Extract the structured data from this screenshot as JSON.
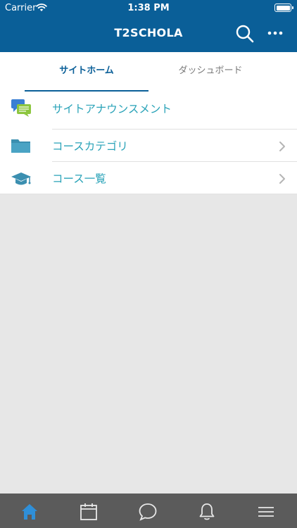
{
  "status_bar": {
    "carrier": "Carrier",
    "time": "1:38 PM"
  },
  "header": {
    "title": "T2SCHOLA",
    "search_icon": "search-icon",
    "more_icon": "more-icon"
  },
  "tabs": [
    {
      "label": "サイトホーム",
      "active": true
    },
    {
      "label": "ダッシュボード",
      "active": false
    }
  ],
  "menu": [
    {
      "label": "サイトアナウンスメント",
      "icon": "announcement-icon",
      "chevron": false
    },
    {
      "label": "コースカテゴリ",
      "icon": "folder-icon",
      "chevron": true
    },
    {
      "label": "コース一覧",
      "icon": "graduation-cap-icon",
      "chevron": true
    }
  ],
  "tab_bar": [
    {
      "icon": "home-icon",
      "active": true
    },
    {
      "icon": "calendar-icon",
      "active": false
    },
    {
      "icon": "chat-icon",
      "active": false
    },
    {
      "icon": "bell-icon",
      "active": false
    },
    {
      "icon": "menu-icon",
      "active": false
    }
  ],
  "colors": {
    "header_bg": "#0a5f98",
    "accent": "#2aa3b8",
    "tabbar_bg": "#5b5b5b",
    "home_active": "#2f8fd8"
  }
}
